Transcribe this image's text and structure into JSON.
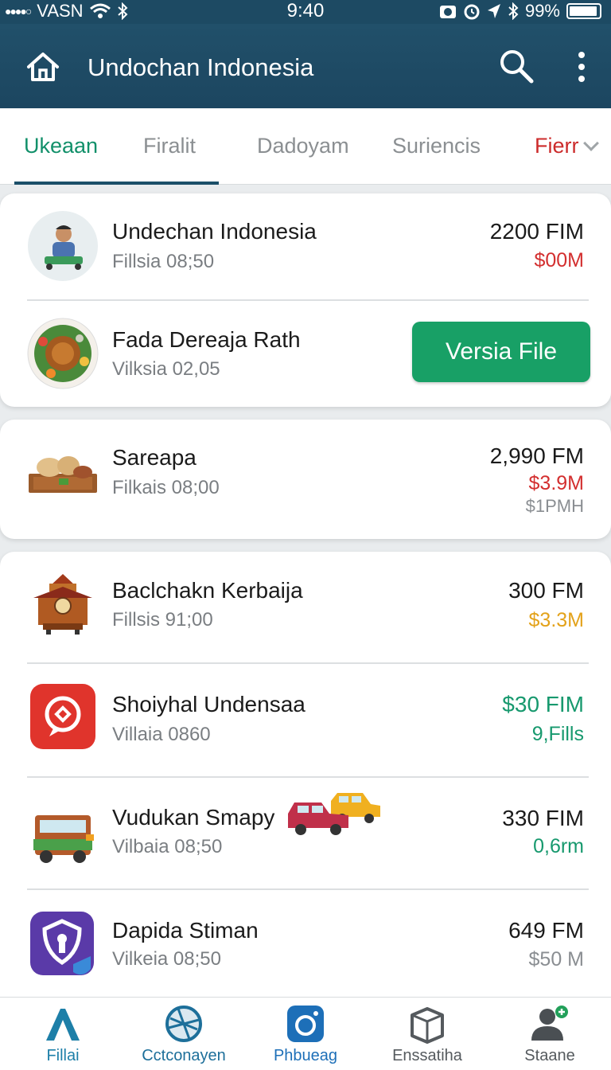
{
  "status_bar": {
    "carrier": "VASN",
    "time": "9:40",
    "battery": "99%"
  },
  "app_bar": {
    "title": "Undochan Indonesia"
  },
  "tabs": [
    {
      "label": "Ukeaan",
      "active": true
    },
    {
      "label": "Firalit"
    },
    {
      "label": "Dadoyam"
    },
    {
      "label": "Suriencis"
    },
    {
      "label": "Fierr"
    }
  ],
  "items": [
    {
      "name": "Undechan Indonesia",
      "sub": "Fillsia 08;50",
      "price": "2200 FIM",
      "amount": "$00M",
      "amount_color": "#d32f2f"
    },
    {
      "name": "Fada Dereaja Rath",
      "sub": "Vilksia 02,05",
      "button": "Versia File"
    },
    {
      "name": "Sareapa",
      "sub": "Filkais 08;00",
      "price": "2,990 FM",
      "amount": "$3.9M",
      "amount_color": "#d32f2f",
      "amount2": "$1PMH"
    },
    {
      "name": "Baclchakn Kerbaija",
      "sub": "Fillsis 91;00",
      "price": "300 FM",
      "amount": "$3.3M",
      "amount_color": "#e3a21a"
    },
    {
      "name": "Shoiyhal Undensaa",
      "sub": "Villaia 0860",
      "price": "$30 FIM",
      "price_color": "#17996e",
      "amount": "9,Fills",
      "amount_color": "#17996e"
    },
    {
      "name": "Vudukan Smapy",
      "sub": "Vilbaia 08;50",
      "price": "330 FIM",
      "amount": "0,6rm",
      "amount_color": "#17996e"
    },
    {
      "name": "Dapida Stiman",
      "sub": "Vilkeia 08;50",
      "price": "649 FM",
      "amount": "$50 M",
      "amount_color": "#8a8e92"
    }
  ],
  "bottom_nav": [
    {
      "label": "Fillai",
      "color": "#1d7fa8"
    },
    {
      "label": "Cctconayen",
      "color": "#1d6f9a"
    },
    {
      "label": "Phbueag",
      "color": "#1d6fb8"
    },
    {
      "label": "Enssatiha",
      "color": "#555a5e"
    },
    {
      "label": "Staane",
      "color": "#555a5e"
    }
  ]
}
